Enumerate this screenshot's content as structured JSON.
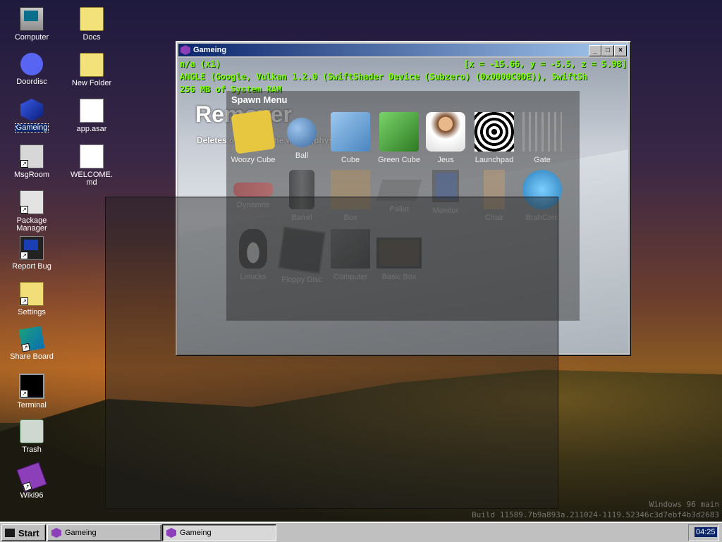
{
  "desktop": {
    "icons_col1": [
      {
        "label": "Computer",
        "icon": "computer-icon",
        "shortcut": false
      },
      {
        "label": "Doordisc",
        "icon": "discord-icon",
        "shortcut": false
      },
      {
        "label": "Gameing",
        "icon": "gameing-icon",
        "shortcut": true,
        "selected": true
      },
      {
        "label": "MsgRoom",
        "icon": "msgroom-icon",
        "shortcut": true
      },
      {
        "label": "Package Manager",
        "icon": "package-icon",
        "shortcut": true
      },
      {
        "label": "Report Bug",
        "icon": "bug-report-icon",
        "shortcut": true
      },
      {
        "label": "Settings",
        "icon": "settings-icon",
        "shortcut": true
      },
      {
        "label": "Share Board",
        "icon": "share-board-icon",
        "shortcut": true
      },
      {
        "label": "Terminal",
        "icon": "terminal-icon",
        "shortcut": true
      },
      {
        "label": "Trash",
        "icon": "trash-icon",
        "shortcut": false
      },
      {
        "label": "Wiki96",
        "icon": "wiki-icon",
        "shortcut": true
      }
    ],
    "icons_col2": [
      {
        "label": "Docs",
        "icon": "folder-icon"
      },
      {
        "label": "New Folder",
        "icon": "folder-icon"
      },
      {
        "label": "app.asar",
        "icon": "file-icon"
      },
      {
        "label": "WELCOME.md",
        "icon": "markdown-file-icon"
      }
    ],
    "build_line1": "Windows 96 main",
    "build_line2": "Build 11589.7b9a893a.211024-1119.52346c3d7ebf4b3d2683"
  },
  "window": {
    "title": "Gameing",
    "minimize": "_",
    "maximize": "□",
    "close": "×",
    "hud_left": "n/a (x1)",
    "hud_coords": "[x = -15.66, y = -5.5, z = 5.98]",
    "hud_renderer": "ANGLE (Google, Vulkan 1.2.0 (SwiftShader Device (Subzero) (0x0000C0DE)), SwiftSh",
    "hud_ram": "256 MB of System RAM",
    "tool_title": "Remover",
    "tool_desc": "Deletes objects in the world (physics only)."
  },
  "spawn_menu": {
    "title": "Spawn Menu",
    "items": [
      {
        "label": "Woozy Cube",
        "icon": "woozy-cube-icon"
      },
      {
        "label": "Ball",
        "icon": "ball-icon"
      },
      {
        "label": "Cube",
        "icon": "cube-icon"
      },
      {
        "label": "Green Cube",
        "icon": "green-cube-icon"
      },
      {
        "label": "Jeus",
        "icon": "jeus-icon"
      },
      {
        "label": "Launchpad",
        "icon": "launchpad-icon"
      },
      {
        "label": "Gate",
        "icon": "gate-icon"
      },
      {
        "label": "Dynamite",
        "icon": "dynamite-icon"
      },
      {
        "label": "Barrel",
        "icon": "barrel-icon"
      },
      {
        "label": "Box",
        "icon": "box-icon"
      },
      {
        "label": "Pallet",
        "icon": "pallet-icon"
      },
      {
        "label": "Monitor",
        "icon": "monitor-icon"
      },
      {
        "label": "Chair",
        "icon": "chair-icon"
      },
      {
        "label": "BrahCorn",
        "icon": "brahcorn-icon"
      },
      {
        "label": "Linucks",
        "icon": "linux-icon"
      },
      {
        "label": "Floppy Disc",
        "icon": "floppy-icon"
      },
      {
        "label": "Computer",
        "icon": "computer-prop-icon"
      },
      {
        "label": "Basic Box",
        "icon": "basic-box-icon"
      }
    ]
  },
  "taskbar": {
    "start_label": "Start",
    "tasks": [
      {
        "label": "Gameing",
        "active": false
      },
      {
        "label": "Gameing",
        "active": true
      }
    ],
    "clock": "04:25"
  },
  "colors": {
    "hud_text": "#7fff00",
    "titlebar_start": "#0a246a",
    "titlebar_end": "#a6caf0",
    "taskbar": "#c0c0c0"
  }
}
